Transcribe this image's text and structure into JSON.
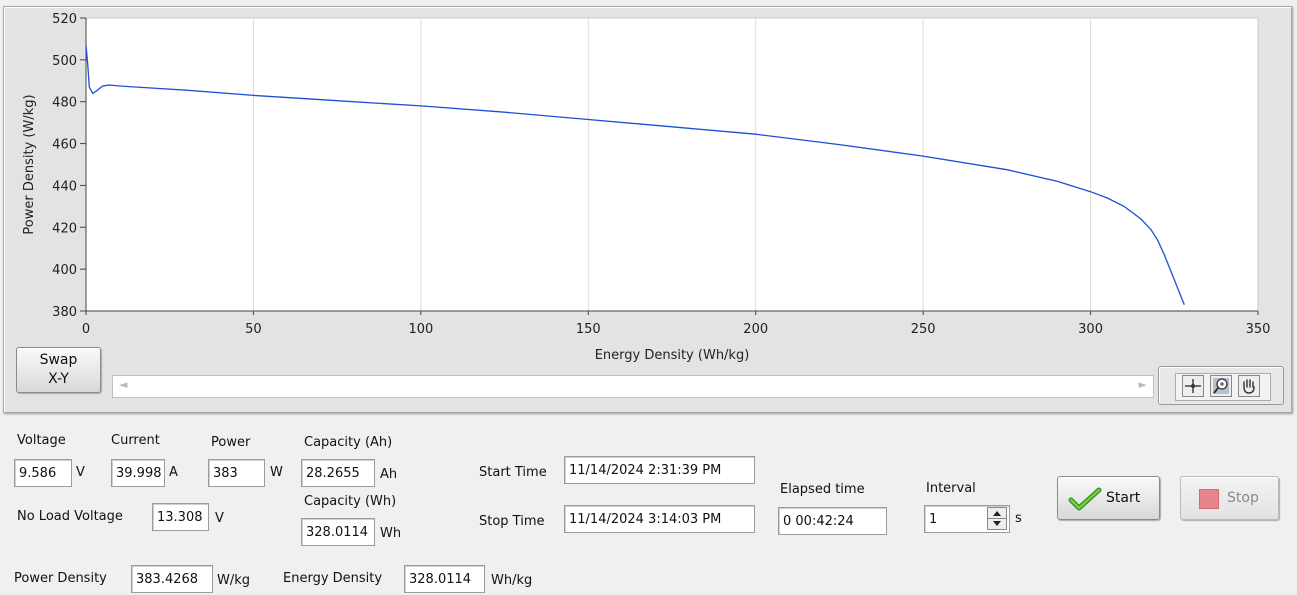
{
  "chart_data": {
    "type": "line",
    "xlabel": "Energy Density (Wh/kg)",
    "ylabel": "Power Density (W/kg)",
    "xlim": [
      0,
      350
    ],
    "ylim": [
      380,
      520
    ],
    "x_ticks": [
      "0",
      "50",
      "100",
      "150",
      "200",
      "250",
      "300",
      "350"
    ],
    "y_ticks": [
      "380",
      "400",
      "420",
      "440",
      "460",
      "480",
      "500",
      "520"
    ],
    "grid": "vertical",
    "line_color": "#1a4fd6",
    "series": [
      {
        "x": [
          0,
          0.5,
          1,
          2,
          3,
          5,
          7,
          10,
          20,
          30,
          50,
          75,
          100,
          125,
          150,
          175,
          200,
          225,
          250,
          275,
          290,
          300,
          305,
          310,
          315,
          318,
          320,
          322,
          324,
          326,
          328
        ],
        "y": [
          507,
          498,
          487,
          484,
          485,
          487.5,
          488,
          487.5,
          486.5,
          485.5,
          483,
          480.5,
          478,
          475,
          471.5,
          468,
          464.5,
          459.5,
          454,
          447.5,
          442,
          437,
          434,
          430,
          424,
          419,
          414,
          407,
          399,
          391,
          383
        ]
      }
    ]
  },
  "graph": {
    "swap_label_1": "Swap",
    "swap_label_2": "X-Y",
    "scroll_left": "◄",
    "scroll_right": "►"
  },
  "readouts": {
    "voltage_label": "Voltage",
    "voltage_value": "9.586",
    "voltage_unit": "V",
    "current_label": "Current",
    "current_value": "39.998",
    "current_unit": "A",
    "power_label": "Power",
    "power_value": "383",
    "power_unit": "W",
    "capacity_ah_label": "Capacity (Ah)",
    "capacity_ah_value": "28.2655",
    "capacity_ah_unit": "Ah",
    "capacity_wh_label": "Capacity (Wh)",
    "capacity_wh_value": "328.0114",
    "capacity_wh_unit": "Wh",
    "no_load_label": "No Load Voltage",
    "no_load_value": "13.308",
    "no_load_unit": "V",
    "start_time_label": "Start Time",
    "start_time_value": "11/14/2024 2:31:39 PM",
    "stop_time_label": "Stop Time",
    "stop_time_value": "11/14/2024 3:14:03 PM",
    "elapsed_label": "Elapsed time",
    "elapsed_value": "0  00:42:24",
    "interval_label": "Interval",
    "interval_value": "1",
    "interval_unit": "s",
    "power_density_label": "Power Density",
    "power_density_value": "383.4268",
    "power_density_unit": "W/kg",
    "energy_density_label": "Energy Density",
    "energy_density_value": "328.0114",
    "energy_density_unit": "Wh/kg"
  },
  "controls": {
    "start_label": "Start",
    "stop_label": "Stop"
  }
}
